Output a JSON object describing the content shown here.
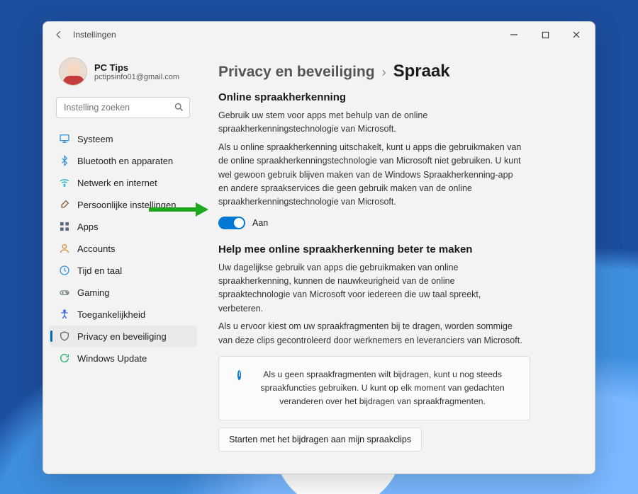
{
  "window_title": "Instellingen",
  "profile": {
    "name": "PC Tips",
    "email": "pctipsinfo01@gmail.com"
  },
  "search": {
    "placeholder": "Instelling zoeken"
  },
  "nav": [
    {
      "id": "systeem",
      "label": "Systeem",
      "icon": "monitor-icon",
      "color": "#3a95d8"
    },
    {
      "id": "bluetooth",
      "label": "Bluetooth en apparaten",
      "icon": "bluetooth-icon",
      "color": "#3a95d8"
    },
    {
      "id": "netwerk",
      "label": "Netwerk en internet",
      "icon": "wifi-icon",
      "color": "#1db2c8"
    },
    {
      "id": "persoonlijk",
      "label": "Persoonlijke instellingen",
      "icon": "brush-icon",
      "color": "#8a5a3a"
    },
    {
      "id": "apps",
      "label": "Apps",
      "icon": "apps-icon",
      "color": "#5a6a7a"
    },
    {
      "id": "accounts",
      "label": "Accounts",
      "icon": "person-icon",
      "color": "#d88a3a"
    },
    {
      "id": "tijd",
      "label": "Tijd en taal",
      "icon": "clock-icon",
      "color": "#3a95d8"
    },
    {
      "id": "gaming",
      "label": "Gaming",
      "icon": "gamepad-icon",
      "color": "#7a8a8a"
    },
    {
      "id": "toegankelijkheid",
      "label": "Toegankelijkheid",
      "icon": "accessibility-icon",
      "color": "#3a6ad8"
    },
    {
      "id": "privacy",
      "label": "Privacy en beveiliging",
      "icon": "shield-icon",
      "color": "#6a6a6a",
      "selected": true
    },
    {
      "id": "update",
      "label": "Windows Update",
      "icon": "update-icon",
      "color": "#1db26a"
    }
  ],
  "breadcrumb": {
    "parent": "Privacy en beveiliging",
    "current": "Spraak"
  },
  "section1": {
    "heading": "Online spraakherkenning",
    "p1": "Gebruik uw stem voor apps met behulp van de online spraakherkenningstechnologie van Microsoft.",
    "p2": "Als u online spraakherkenning uitschakelt, kunt u apps die gebruikmaken van de online spraakherkenningstechnologie van Microsoft niet gebruiken. U kunt wel gewoon gebruik blijven maken van de Windows Spraakherkenning-app en andere spraakservices die geen gebruik maken van de online spraakherkenningstechnologie van Microsoft.",
    "toggle_label": "Aan",
    "toggle_state": "on"
  },
  "section2": {
    "heading": "Help mee online spraakherkenning beter te maken",
    "p1": "Uw dagelijkse gebruik van apps die gebruikmaken van online spraakherkenning, kunnen de nauwkeurigheid van de online spraaktechnologie van Microsoft voor iedereen die uw taal spreekt, verbeteren.",
    "p2": "Als u ervoor kiest om uw spraakfragmenten bij te dragen, worden sommige van deze clips gecontroleerd door werknemers en leveranciers van Microsoft.",
    "info": "Als u geen spraakfragmenten wilt bijdragen, kunt u nog steeds spraakfuncties gebruiken. U kunt op elk moment van gedachten veranderen over het bijdragen van spraakfragmenten.",
    "button": "Starten met het bijdragen aan mijn spraakclips"
  }
}
